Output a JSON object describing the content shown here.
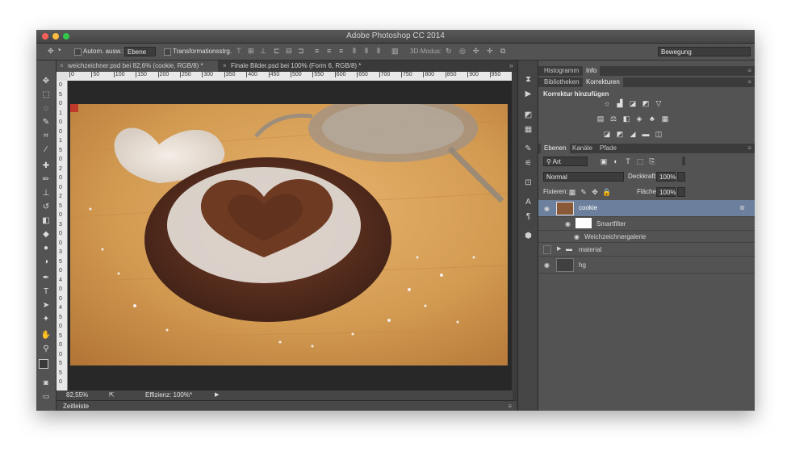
{
  "window": {
    "title": "Adobe Photoshop CC 2014",
    "traffic_lights": {
      "close": "#fc605b",
      "minimize": "#fdbc40",
      "zoom": "#34c84a"
    }
  },
  "options_bar": {
    "auto_select_label": "Autom. ausw.:",
    "auto_select_target": "Ebene",
    "transform_label": "Transformationsstrg.",
    "mode_3d_label": "3D-Modus:",
    "workspace": "Bewegung"
  },
  "document_tabs": [
    {
      "label": "weichzeichner.psd bei 82,6% (cookie, RGB/8) *"
    },
    {
      "label": "Finale Bilder.psd bei 100% (Form 6, RGB/8) *"
    }
  ],
  "ruler": {
    "h_ticks": [
      "0",
      "50",
      "100",
      "150",
      "200",
      "250",
      "300",
      "350",
      "400",
      "450",
      "500",
      "550",
      "600",
      "650",
      "700",
      "750",
      "800",
      "850",
      "900",
      "950"
    ],
    "v_ticks": [
      "0",
      "5",
      "0",
      "1",
      "0",
      "0",
      "1",
      "5",
      "0",
      "2",
      "0",
      "0",
      "2",
      "5",
      "0",
      "3",
      "0",
      "0",
      "3",
      "5",
      "0",
      "4",
      "0",
      "0",
      "4",
      "5",
      "0",
      "5",
      "0",
      "0",
      "5",
      "5",
      "0"
    ]
  },
  "status_bar": {
    "zoom": "82,55%",
    "efficiency": "Effizienz: 100%*"
  },
  "timeline": {
    "label": "Zeitleiste"
  },
  "panels": {
    "top_tabs": [
      "Histogramm",
      "Info"
    ],
    "adjust_tabs": [
      "Bibliotheken",
      "Korrekturen"
    ],
    "adjust_title": "Korrektur hinzufügen",
    "layers_tabs": [
      "Ebenen",
      "Kanäle",
      "Pfade"
    ],
    "filter_kind": "Art",
    "blend_mode": "Normal",
    "opacity_label": "Deckkraft:",
    "opacity": "100%",
    "lock_label": "Fixieren:",
    "fill_label": "Fläche:",
    "fill": "100%",
    "layers": [
      {
        "name": "cookie",
        "selected": true
      },
      {
        "name": "Smartfilter"
      },
      {
        "name": "Weichzeichnergalerie"
      },
      {
        "name": "material"
      },
      {
        "name": "hg"
      }
    ]
  },
  "colors": {
    "selection": "#6c7f9c",
    "panel_bg": "#535353",
    "app_bg": "#3a3a3a"
  }
}
